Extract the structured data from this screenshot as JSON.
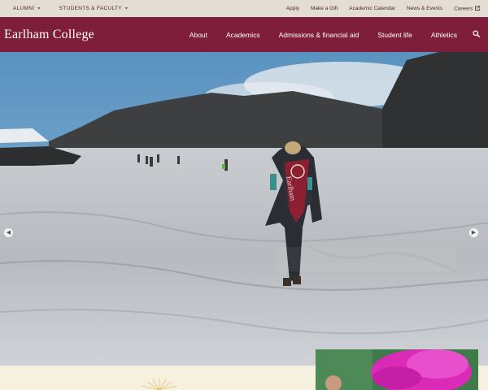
{
  "utility": {
    "alumni": "ALUMNI",
    "students_faculty": "STUDENTS & FACULTY",
    "links": [
      "Apply",
      "Make a Gift",
      "Academic Calendar",
      "News & Events",
      "Careers"
    ]
  },
  "nav": {
    "logo": "Earlham College",
    "links": [
      "About",
      "Academics",
      "Admissions & financial aid",
      "Student life",
      "Athletics"
    ]
  },
  "icons": {
    "chevron": "chevron-down-icon",
    "external": "external-link-icon",
    "search": "search-icon",
    "prev": "arrow-left-icon",
    "next": "arrow-right-icon"
  },
  "colors": {
    "brand": "#7e1e3b",
    "utility_bg": "#e4ddd3",
    "cream": "#f6f1df"
  },
  "hero": {
    "banner_text": "Earlham"
  }
}
